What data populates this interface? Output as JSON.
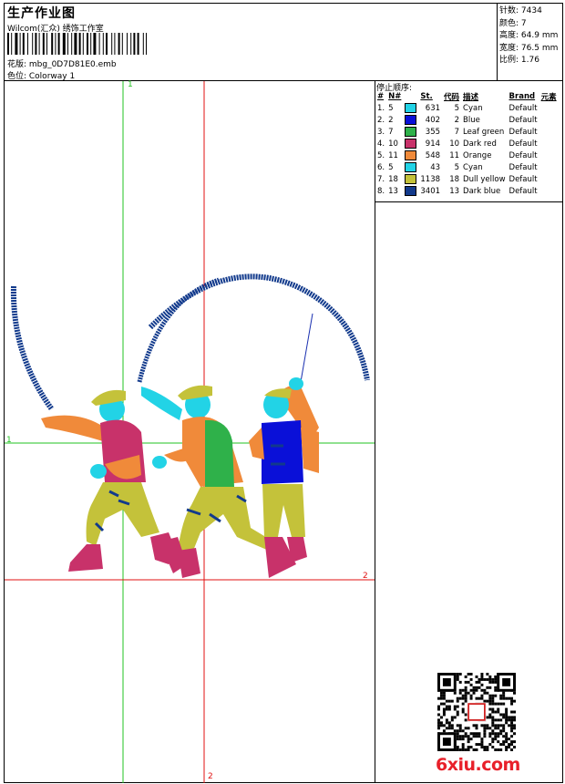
{
  "header": {
    "title": "生产作业图",
    "company": "Wilcom(汇众) 绣饰工作室",
    "design_line": "花版: mbg_0D7D81E0.emb",
    "colorway_line": "色位: Colorway 1"
  },
  "stats": [
    {
      "label": "针数:",
      "value": "7434"
    },
    {
      "label": "颜色:",
      "value": "7"
    },
    {
      "label": "高度:",
      "value": "64.9 mm"
    },
    {
      "label": "宽度:",
      "value": "76.5 mm"
    },
    {
      "label": "比例:",
      "value": "1.76"
    }
  ],
  "sequence": {
    "heading": "停止顺序:",
    "columns": [
      "#",
      "N#",
      "St.",
      "代码",
      "描述",
      "Brand",
      "元素"
    ],
    "rows": [
      {
        "idx": "1.",
        "n": "5",
        "color": "#22d3e6",
        "st": "631",
        "code": "5",
        "desc": "Cyan",
        "brand": "Default"
      },
      {
        "idx": "2.",
        "n": "2",
        "color": "#0a10d8",
        "st": "402",
        "code": "2",
        "desc": "Blue",
        "brand": "Default"
      },
      {
        "idx": "3.",
        "n": "7",
        "color": "#2fb14a",
        "st": "355",
        "code": "7",
        "desc": "Leaf green",
        "brand": "Default"
      },
      {
        "idx": "4.",
        "n": "10",
        "color": "#c8326a",
        "st": "914",
        "code": "10",
        "desc": "Dark red",
        "brand": "Default"
      },
      {
        "idx": "5.",
        "n": "11",
        "color": "#f08a3a",
        "st": "548",
        "code": "11",
        "desc": "Orange",
        "brand": "Default"
      },
      {
        "idx": "6.",
        "n": "5",
        "color": "#22d3e6",
        "st": "43",
        "code": "5",
        "desc": "Cyan",
        "brand": "Default"
      },
      {
        "idx": "7.",
        "n": "18",
        "color": "#c4c23a",
        "st": "1138",
        "code": "18",
        "desc": "Dull yellow",
        "brand": "Default"
      },
      {
        "idx": "8.",
        "n": "13",
        "color": "#123a8c",
        "st": "3401",
        "code": "13",
        "desc": "Dark blue",
        "brand": "Default"
      }
    ]
  },
  "guides": {
    "green_label": "1",
    "red_label": "2"
  },
  "watermark": "6xiu.com"
}
